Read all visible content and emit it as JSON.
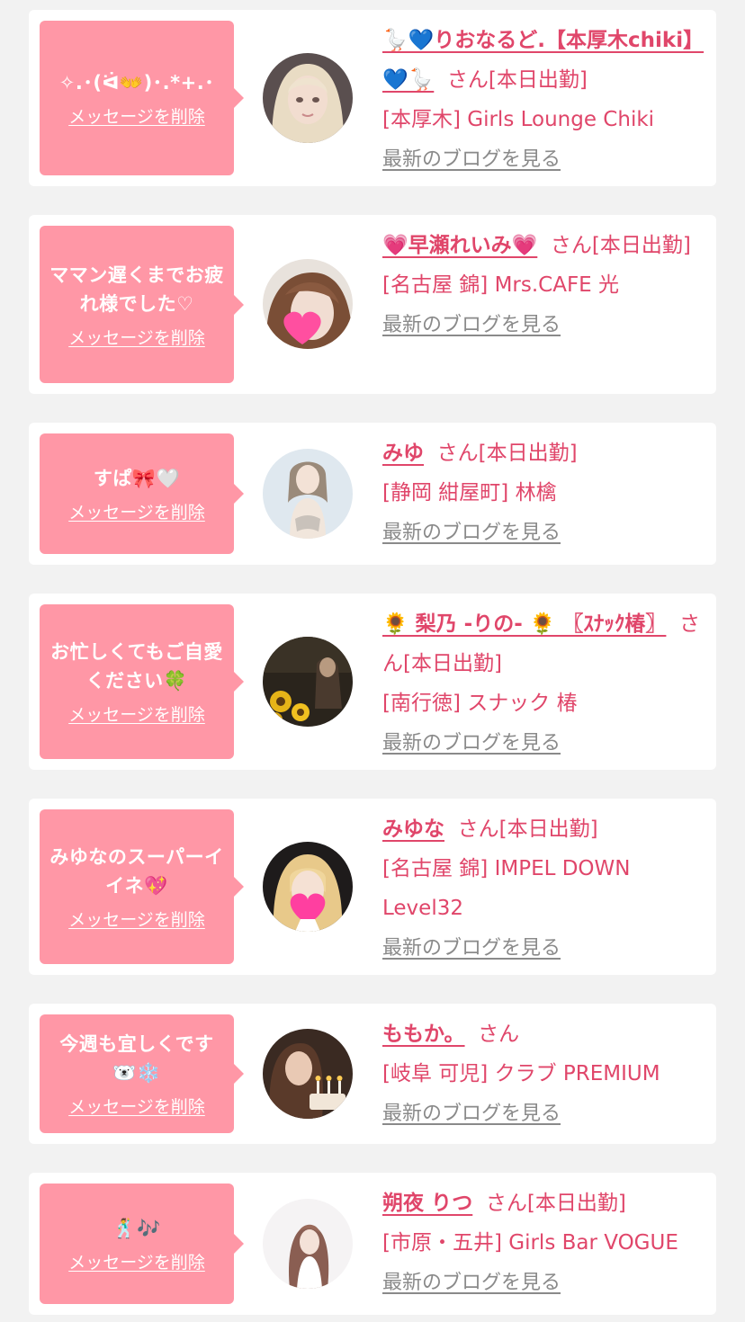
{
  "theme": {
    "bubble_color": "#ff97a6",
    "accent_color": "#e0466a",
    "link_gray": "#8a8a8a",
    "background": "#f2f2f2"
  },
  "common": {
    "delete_label": "メッセージを削除",
    "blog_label": "最新のブログを見る"
  },
  "messages": [
    {
      "text": "✧.･(ᐛ👐)･.*+.･",
      "name": "🪿💙りおなるど.【本厚木chiki】💙🪿",
      "suffix": "さん[本日出勤]",
      "shop": "[本厚木] Girls Lounge Chiki",
      "avatar_icon": "blonde-woman-photo-icon"
    },
    {
      "text": "ママン遅くまでお疲れ様でした♡",
      "name": "💗早瀬れいみ💗",
      "suffix": "さん[本日出勤]",
      "shop": "[名古屋 錦] Mrs.CAFE 光",
      "avatar_icon": "woman-with-heart-sticker-photo-icon"
    },
    {
      "text": "すぱ🎀🤍",
      "name": "みゆ",
      "suffix": "さん[本日出勤]",
      "shop": "[静岡 紺屋町] 林檎",
      "avatar_icon": "woman-in-white-photo-icon"
    },
    {
      "text": "お忙しくてもご自愛ください🍀",
      "name": "🌻 梨乃 -りの- 🌻 〖ｽﾅｯｸ椿〗",
      "suffix": "さん[本日出勤]",
      "shop": "[南行徳] スナック 椿",
      "avatar_icon": "sunflower-night-photo-icon"
    },
    {
      "text": "みゆなのスーパーイイネ💖",
      "name": "みゆな",
      "suffix": "さん[本日出勤]",
      "shop": "[名古屋 錦] IMPEL DOWN Level32",
      "avatar_icon": "blonde-woman-with-heart-sticker-photo-icon"
    },
    {
      "text": "今週も宜しくです🐻‍❄️❄️",
      "name": "ももか。",
      "suffix": "さん",
      "shop": "[岐阜 可児] クラブ PREMIUM",
      "avatar_icon": "woman-with-candles-photo-icon"
    },
    {
      "text": "🕺🎶",
      "name": "朔夜 りつ",
      "suffix": "さん[本日出勤]",
      "shop": "[市原・五井] Girls Bar VOGUE",
      "avatar_icon": "woman-on-white-photo-icon"
    }
  ]
}
